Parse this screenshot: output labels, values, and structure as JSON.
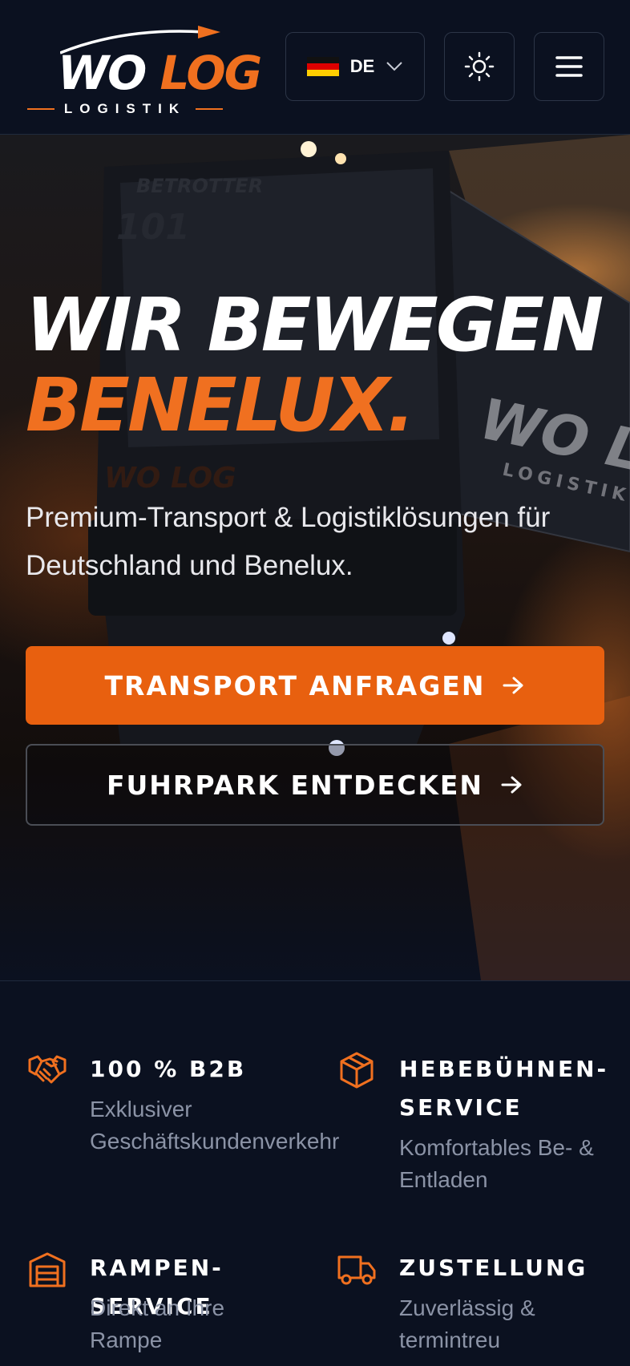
{
  "header": {
    "logo": {
      "word1": "WO",
      "word2": "LOG",
      "subtitle": "LOGISTIK"
    },
    "language": {
      "code": "DE",
      "flag": "germany-flag-icon"
    },
    "theme_toggle_icon": "sun-icon",
    "menu_icon": "hamburger-menu-icon"
  },
  "hero": {
    "title_line1": "WIR BEWEGEN",
    "title_line2": "BENELUX.",
    "subtitle": "Premium-Transport & Logistiklösungen für Deutschland und Benelux.",
    "primary_cta": "TRANSPORT ANFRAGEN",
    "secondary_cta": "FUHRPARK ENTDECKEN",
    "truck_livery": [
      "BETROTTER",
      "101",
      "WO LOG",
      "LOGISTIK"
    ]
  },
  "features": [
    {
      "icon": "handshake-icon",
      "title": "100 % B2B",
      "desc": "Exklusiver Geschäftskundenverkehr"
    },
    {
      "icon": "box-icon",
      "title": "HEBEBÜHNEN-SERVICE",
      "title_line1": "HEBEBÜHNEN-",
      "title_line2": "SERVICE",
      "desc": "Komfortables Be- & Entladen"
    },
    {
      "icon": "warehouse-icon",
      "title": "RAMPEN-SERVICE",
      "desc": "Direkt an Ihre Rampe"
    },
    {
      "icon": "truck-icon",
      "title": "ZUSTELLUNG",
      "desc": "Zuverlässig & termintreu"
    }
  ],
  "colors": {
    "accent": "#e8600f",
    "background": "#0b1120",
    "muted_text": "#8b93a6",
    "border": "#2c3547"
  }
}
